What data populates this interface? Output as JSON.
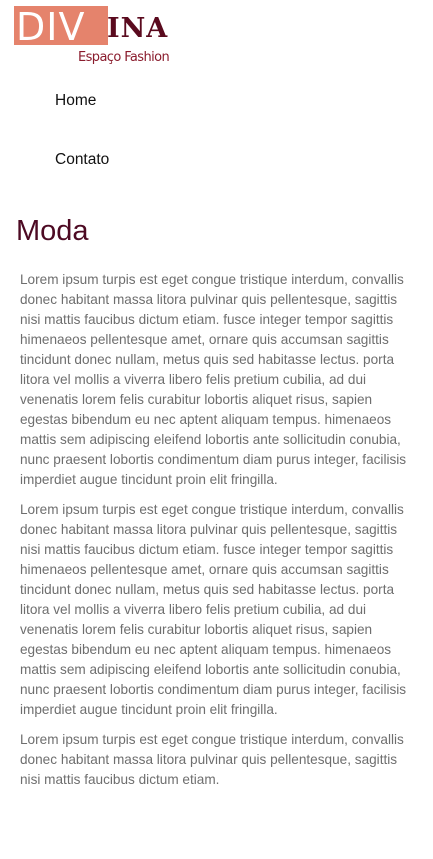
{
  "logo": {
    "part1": "DIV",
    "part2": "INA",
    "tagline": "Espaço Fashion"
  },
  "nav": {
    "items": [
      {
        "label": "Home"
      },
      {
        "label": "Contato"
      }
    ]
  },
  "page": {
    "title": "Moda"
  },
  "paragraphs": [
    "Lorem ipsum turpis est eget congue tristique interdum, convallis donec habitant massa litora pulvinar quis pellentesque, sagittis nisi mattis faucibus dictum etiam. fusce integer tempor sagittis himenaeos pellentesque amet, ornare quis accumsan sagittis tincidunt donec nullam, metus quis sed habitasse lectus. porta litora vel mollis a viverra libero felis pretium cubilia, ad dui venenatis lorem felis curabitur lobortis aliquet risus, sapien egestas bibendum eu nec aptent aliquam tempus. himenaeos mattis sem adipiscing eleifend lobortis ante sollicitudin conubia, nunc praesent lobortis condimentum diam purus integer, facilisis imperdiet augue tincidunt proin elit fringilla.",
    "Lorem ipsum turpis est eget congue tristique interdum, convallis donec habitant massa litora pulvinar quis pellentesque, sagittis nisi mattis faucibus dictum etiam. fusce integer tempor sagittis himenaeos pellentesque amet, ornare quis accumsan sagittis tincidunt donec nullam, metus quis sed habitasse lectus. porta litora vel mollis a viverra libero felis pretium cubilia, ad dui venenatis lorem felis curabitur lobortis aliquet risus, sapien egestas bibendum eu nec aptent aliquam tempus. himenaeos mattis sem adipiscing eleifend lobortis ante sollicitudin conubia, nunc praesent lobortis condimentum diam purus integer, facilisis imperdiet augue tincidunt proin elit fringilla.",
    "Lorem ipsum turpis est eget congue tristique interdum, convallis donec habitant massa litora pulvinar quis pellentesque, sagittis nisi mattis faucibus dictum etiam."
  ],
  "colors": {
    "brand_box": "#e5836c",
    "brand_text": "#5a0a1e",
    "title": "#4d0a23",
    "body_text": "#6e6e6e"
  }
}
